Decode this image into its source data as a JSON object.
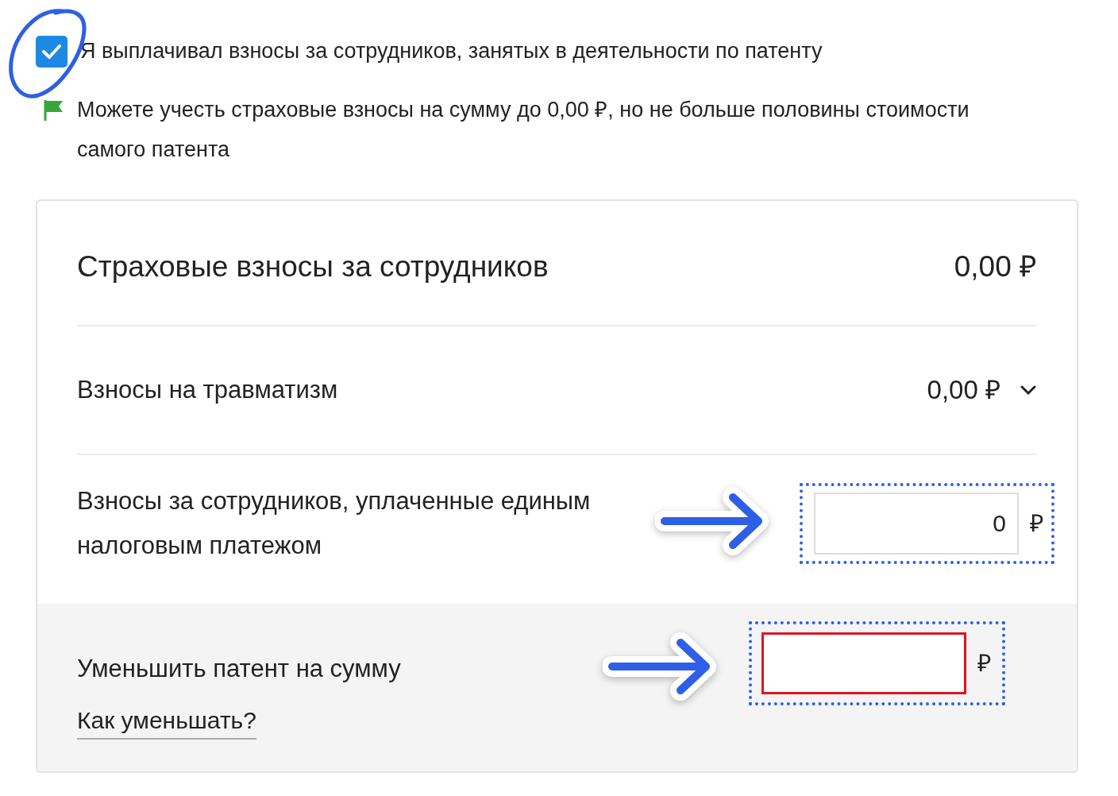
{
  "consent": {
    "label": "Я выплачивал взносы за сотрудников, занятых в деятельности по патенту",
    "checked": true
  },
  "notice": {
    "text": "Можете учесть страховые взносы на сумму до 0,00 ₽, но не больше половины стоимости самого патента"
  },
  "card": {
    "title": "Страховые взносы за сотрудников",
    "total": "0,00 ₽"
  },
  "rows": [
    {
      "kind": "expandable",
      "label": "Взносы на травматизм",
      "amount": "0,00 ₽",
      "expanded": false
    },
    {
      "kind": "input",
      "label": "Взносы за сотрудников, уплаченные единым налоговым платежом",
      "value": "0",
      "currency": "₽",
      "error": false
    }
  ],
  "footer": {
    "label": "Уменьшить патент на сумму",
    "link": "Как уменьшать?",
    "currency": "₽",
    "error": true
  }
}
